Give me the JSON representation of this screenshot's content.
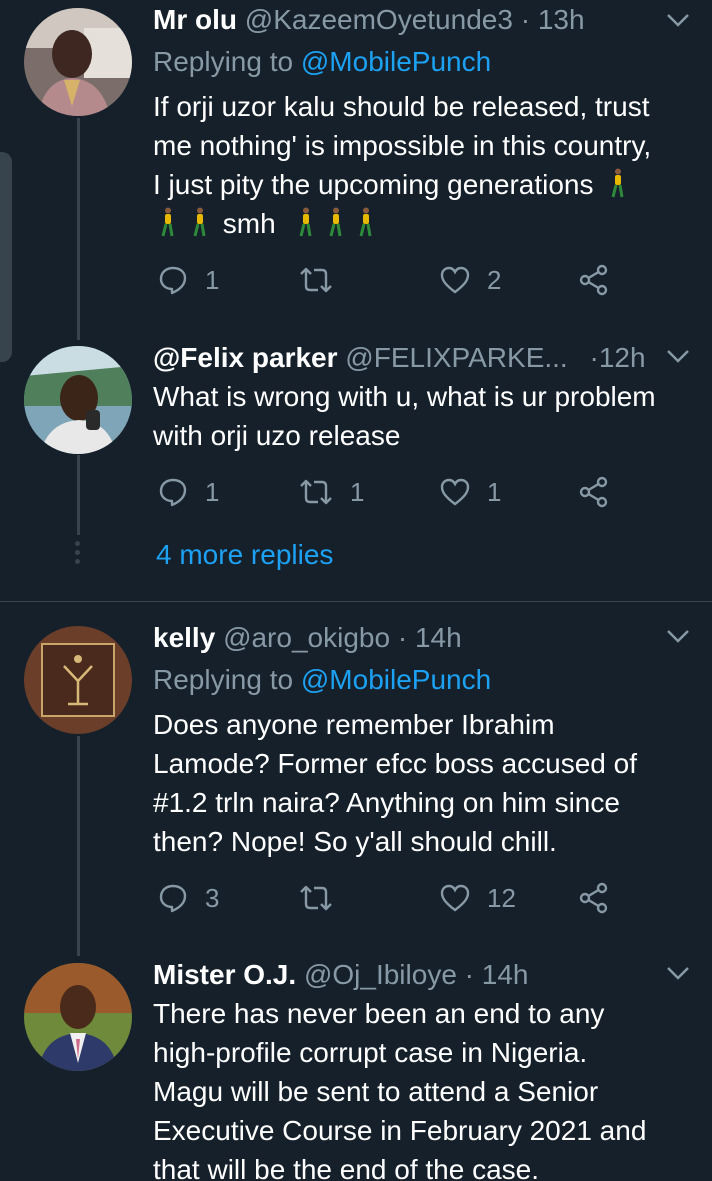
{
  "colors": {
    "background": "#15202b",
    "text": "#ffffff",
    "muted": "#8899a6",
    "link": "#1da1f2",
    "line": "#38444d"
  },
  "tweets": [
    {
      "name": "Mr olu",
      "handle": "@KazeemOyetunde3",
      "time": "13h",
      "replying_prefix": "Replying to ",
      "replying_to": "@MobilePunch",
      "lines": [
        "If orji uzor kalu should be released, trust",
        "me nothing' is impossible in this country,",
        "I just pity the upcoming generations"
      ],
      "tail_word": "smh",
      "emoji_icon": "person-walking-icon",
      "replies": "1",
      "retweets": "",
      "likes": "2"
    },
    {
      "name": "@Felix parker",
      "handle": "@FELIXPARKE...",
      "time": "12h",
      "lines": [
        "What is wrong with u, what is ur problem",
        "with orji uzo release"
      ],
      "replies": "1",
      "retweets": "1",
      "likes": "1"
    },
    {
      "name": "kelly",
      "handle": "@aro_okigbo",
      "time": "14h",
      "replying_prefix": "Replying to ",
      "replying_to": "@MobilePunch",
      "lines": [
        "Does anyone remember Ibrahim",
        "Lamode? Former efcc boss accused of",
        "#1.2 trln naira? Anything on him since",
        "then? Nope! So y'all should chill."
      ],
      "replies": "3",
      "retweets": "",
      "likes": "12"
    },
    {
      "name": "Mister O.J.",
      "handle": "@Oj_Ibiloye",
      "time": "14h",
      "lines": [
        "There has never been an end to any",
        "high-profile corrupt case in Nigeria.",
        "Magu will be sent to attend a Senior",
        "Executive Course in February 2021 and",
        "that will be the end of the case."
      ]
    }
  ],
  "more_replies": "4 more replies",
  "dot_sep": "·"
}
